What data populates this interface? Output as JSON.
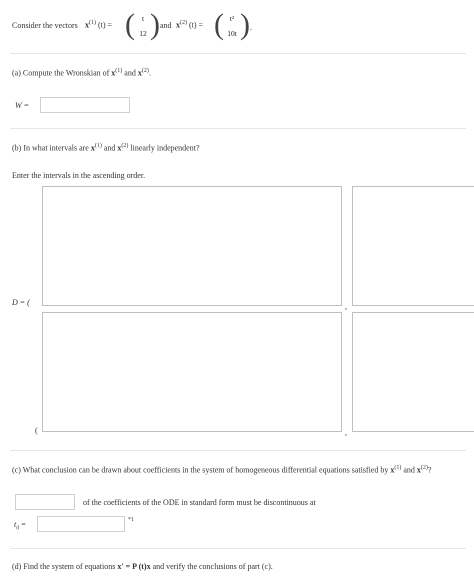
{
  "header": {
    "intro": "Consider the vectors",
    "x1_label": "x",
    "x1_sup": "(1)",
    "x1_arg": "(t) =",
    "x1_top": "t",
    "x1_bottom": "12",
    "and1": "and",
    "x2_label": "x",
    "x2_sup": "(2)",
    "x2_arg": "(t) =",
    "x2_top": "t²",
    "x2_bottom": "10t",
    "end_dot": "."
  },
  "part_a": {
    "question_prefix": "(a) Compute the Wronskian of",
    "x1_label": "x",
    "x1_sup": "(1)",
    "mid": "and",
    "x2_label": "x",
    "x2_sup": "(2)",
    "end": ".",
    "w_label": "W =",
    "w_value": ""
  },
  "part_b": {
    "question_prefix": "(b) In what intervals are",
    "x1_label": "x",
    "x1_sup": "(1)",
    "mid": "and",
    "x2_label": "x",
    "x2_sup": "(2)",
    "question_suffix": "linearly independent?",
    "instruction": "Enter the intervals in the ascending order.",
    "d_label": "D = (",
    "open_paren": "(",
    "comma": ","
  },
  "part_c": {
    "question_prefix": "(c) What conclusion can be drawn about coefficients in the system of homogeneous differential equations satisfied by",
    "x1_label": "x",
    "x1_sup": "(1)",
    "mid": "and",
    "x2_label": "x",
    "x2_sup": "(2)",
    "end": "?",
    "sentence": "of the coefficients of the ODE in standard form must be discontinuous at",
    "t0_label": "t",
    "t0_sub": "0",
    "t0_eq": "=",
    "footnote_marker": "*1",
    "select_value": "",
    "t0_value": ""
  },
  "part_d": {
    "question_prefix": "(d) Find the system of equations",
    "eq": "x′ = P (t)x",
    "question_suffix": "and verify the conclusions of part (c)."
  }
}
